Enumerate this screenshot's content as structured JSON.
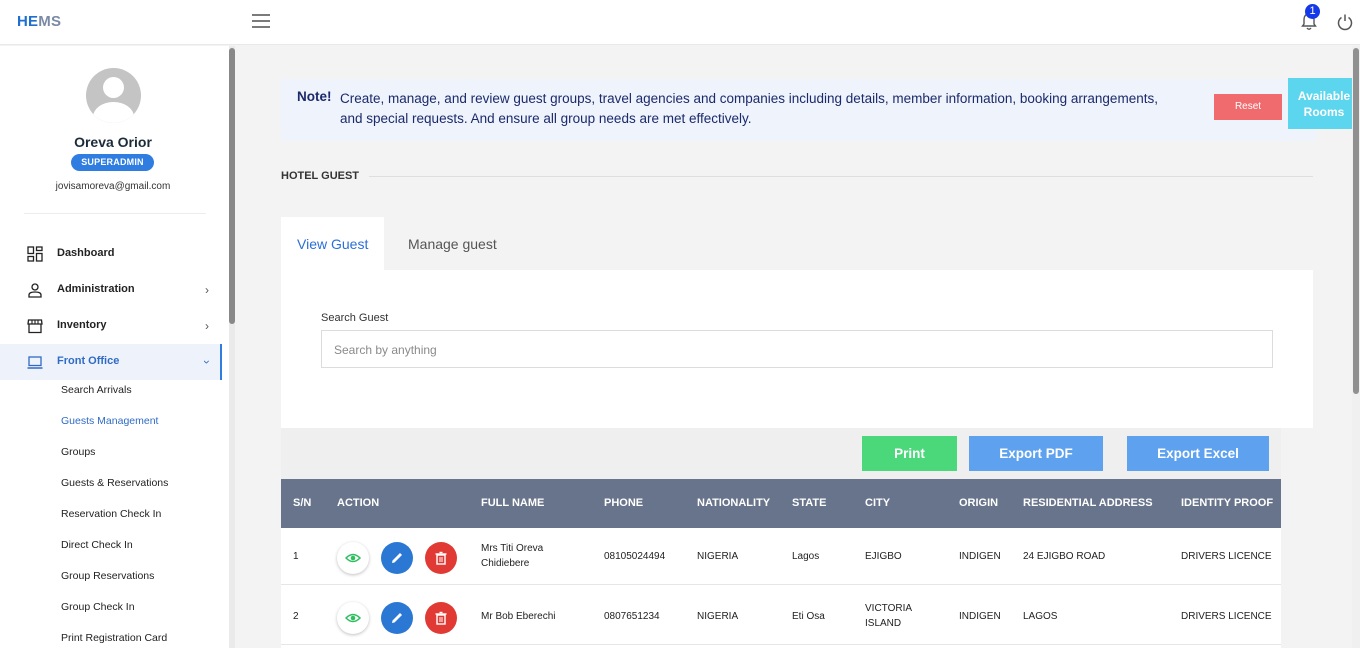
{
  "app": {
    "logo_he": "HE",
    "logo_ms": "MS"
  },
  "topbar": {
    "notification_count": "1"
  },
  "user": {
    "name": "Oreva Orior",
    "role": "SUPERADMIN",
    "email": "jovisamoreva@gmail.com"
  },
  "sidebar": {
    "items": [
      {
        "label": "Dashboard"
      },
      {
        "label": "Administration"
      },
      {
        "label": "Inventory"
      },
      {
        "label": "Front Office"
      }
    ],
    "sub_items": [
      {
        "label": "Search Arrivals"
      },
      {
        "label": "Guests Management"
      },
      {
        "label": "Groups"
      },
      {
        "label": "Guests & Reservations"
      },
      {
        "label": "Reservation Check In"
      },
      {
        "label": "Direct Check In"
      },
      {
        "label": "Group Reservations"
      },
      {
        "label": "Group Check In"
      },
      {
        "label": "Print Registration Card"
      }
    ]
  },
  "note": {
    "label": "Note!",
    "text": "Create, manage, and review guest groups, travel agencies and companies including details, member information, booking arrangements, and special requests. And ensure all group needs are met effectively.",
    "reset_label": "Reset",
    "available_rooms_label": "Available Rooms"
  },
  "section": {
    "title": "HOTEL GUEST"
  },
  "tabs": [
    {
      "label": "View Guest"
    },
    {
      "label": "Manage guest"
    }
  ],
  "search": {
    "label": "Search Guest",
    "placeholder": "Search by anything"
  },
  "toolbar": {
    "print_label": "Print",
    "export_pdf_label": "Export PDF",
    "export_excel_label": "Export Excel"
  },
  "table": {
    "columns": [
      "S/N",
      "ACTION",
      "FULL NAME",
      "PHONE",
      "NATIONALITY",
      "STATE",
      "CITY",
      "ORIGIN",
      "RESIDENTIAL ADDRESS",
      "IDENTITY PROOF"
    ],
    "rows": [
      {
        "sn": "1",
        "name": "Mrs Titi Oreva Chidiebere",
        "phone": "08105024494",
        "nationality": "NIGERIA",
        "state": "Lagos",
        "city": "EJIGBO",
        "origin": "INDIGEN",
        "address": "24 EJIGBO ROAD",
        "identity": "DRIVERS LICENCE"
      },
      {
        "sn": "2",
        "name": "Mr Bob Eberechi",
        "phone": "0807651234",
        "nationality": "NIGERIA",
        "state": "Eti Osa",
        "city": "VICTORIA ISLAND",
        "origin": "INDIGEN",
        "address": "LAGOS",
        "identity": "DRIVERS LICENCE"
      }
    ]
  },
  "colors": {
    "accent": "#2f7de1",
    "table_header": "#68748b",
    "print": "#4bd87b",
    "export": "#5ea2ef",
    "reset": "#f06b6e",
    "available": "#5bd6ee",
    "delete": "#e13a34"
  }
}
